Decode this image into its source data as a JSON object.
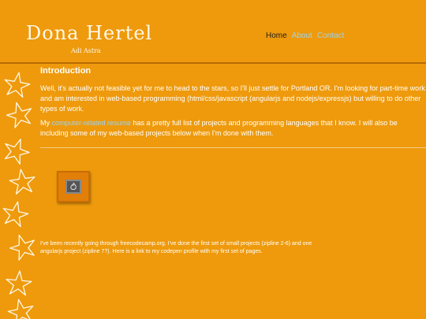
{
  "header": {
    "title": "Dona Hertel",
    "subtitle": "Adi Astra"
  },
  "nav": {
    "items": [
      "Home",
      "About",
      "Contact"
    ]
  },
  "intro": {
    "heading": "Introduction",
    "paragraph1": "Well, it's actually not feasible yet for me to head to the stars, so I'll just settle for Portland OR. I'm looking for part-time work and am interested in web-based programming (html/css/javascript (angularjs and nodejs/expressjs) but willing to do other types of work.",
    "paragraph2_pre": "My ",
    "paragraph2_link": "computer-related resume",
    "paragraph2_post": " has a pretty full list of projects and programming languages that I know. I will also be including some of my web-based projects below when I'm done with them."
  },
  "projects": {
    "codepen_icon": "codepen-icon",
    "description": "I've been recently going through freecodecamp.org. I've done the first set of small projects (zipline 2-6) and one angularjs project (zipline 7?). Here is a link to my codepen profile with my first set of pages."
  },
  "colors": {
    "background": "#ee9a0c",
    "link": "#9fd2e8",
    "active_nav": "#1f1f1f"
  }
}
